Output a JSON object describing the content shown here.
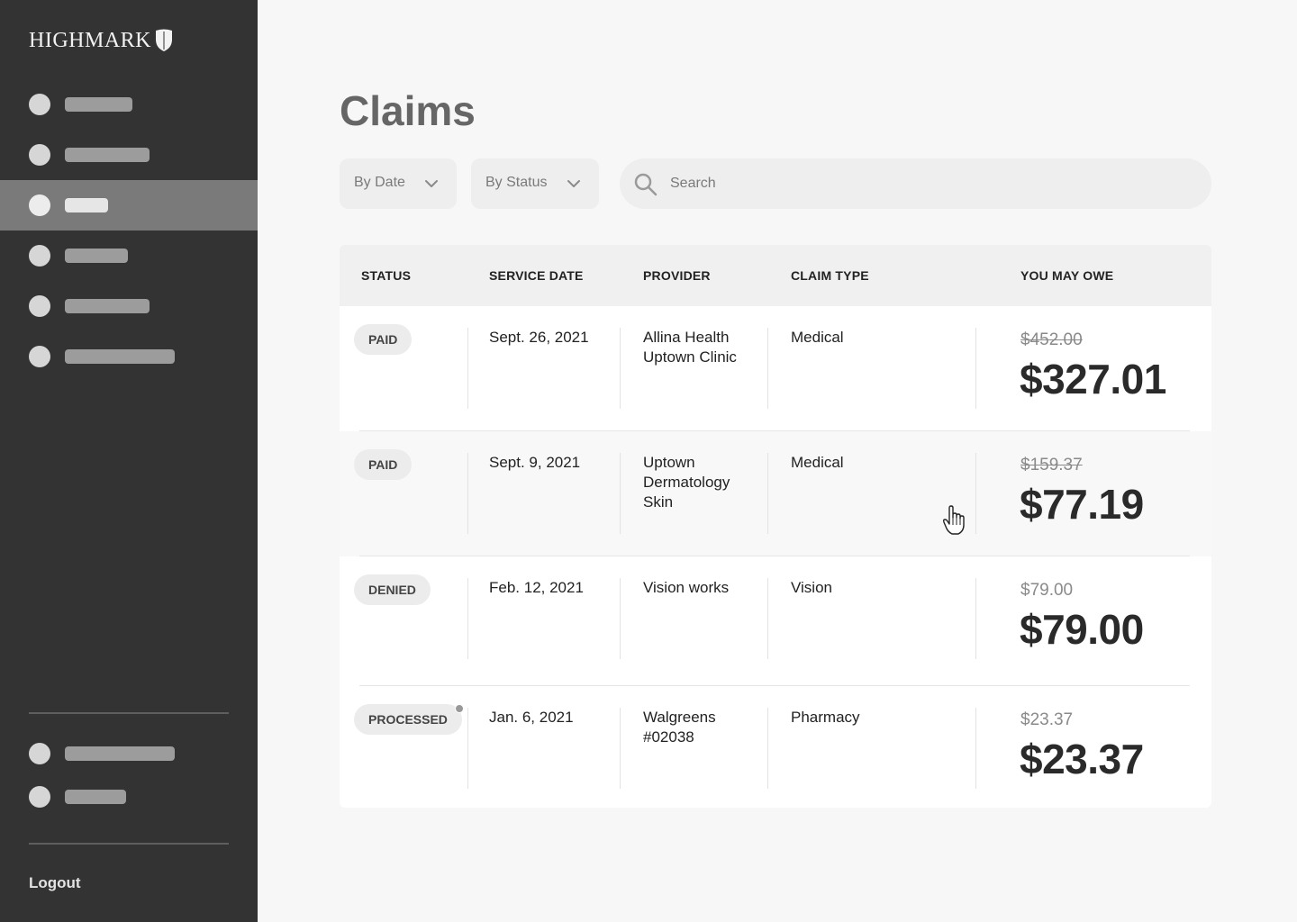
{
  "app": {
    "logo_text": "HIGHMARK",
    "logo_icon": "shield-icon"
  },
  "sidebar": {
    "nav_items": [
      {
        "label_placeholder": "nav item 1",
        "active": false
      },
      {
        "label_placeholder": "nav item 2",
        "active": false
      },
      {
        "label_placeholder": "nav item 3",
        "active": true
      },
      {
        "label_placeholder": "nav item 4",
        "active": false
      },
      {
        "label_placeholder": "nav item 5",
        "active": false
      },
      {
        "label_placeholder": "nav item 6",
        "active": false
      }
    ],
    "footer_items": [
      {
        "label_placeholder": "footer item 1"
      },
      {
        "label_placeholder": "footer item 2"
      }
    ],
    "logout_label": "Logout"
  },
  "main": {
    "title": "Claims",
    "filters": {
      "date_label": "By Date",
      "status_label": "By Status"
    },
    "search": {
      "placeholder": "Search",
      "icon": "search-icon"
    },
    "table": {
      "columns": [
        "STATUS",
        "SERVICE DATE",
        "PROVIDER",
        "CLAIM TYPE",
        "YOU MAY OWE"
      ],
      "rows": [
        {
          "status": "PAID",
          "date": "Sept. 26, 2021",
          "provider_lines": [
            "Allina Health",
            "Uptown Clinic"
          ],
          "type": "Medical",
          "original": "$452.00",
          "original_struck": true,
          "owe": "$327.01",
          "notification": false
        },
        {
          "status": "PAID",
          "date": "Sept. 9, 2021",
          "provider_lines": [
            "Uptown",
            "Dermatology",
            "Skin"
          ],
          "type": "Medical",
          "original": "$159.37",
          "original_struck": true,
          "owe": "$77.19",
          "notification": false
        },
        {
          "status": "DENIED",
          "date": "Feb. 12, 2021",
          "provider_lines": [
            "Vision works"
          ],
          "type": "Vision",
          "original": "$79.00",
          "original_struck": false,
          "owe": "$79.00",
          "notification": false
        },
        {
          "status": "PROCESSED",
          "date": "Jan. 6, 2021",
          "provider_lines": [
            "Walgreens",
            "#02038"
          ],
          "type": "Pharmacy",
          "original": "$23.37",
          "original_struck": false,
          "owe": "$23.37",
          "notification": true
        }
      ]
    }
  },
  "colors": {
    "sidebar_bg": "#333333",
    "active_nav_bg": "#7a7a7a",
    "page_bg": "#f7f7f7"
  }
}
